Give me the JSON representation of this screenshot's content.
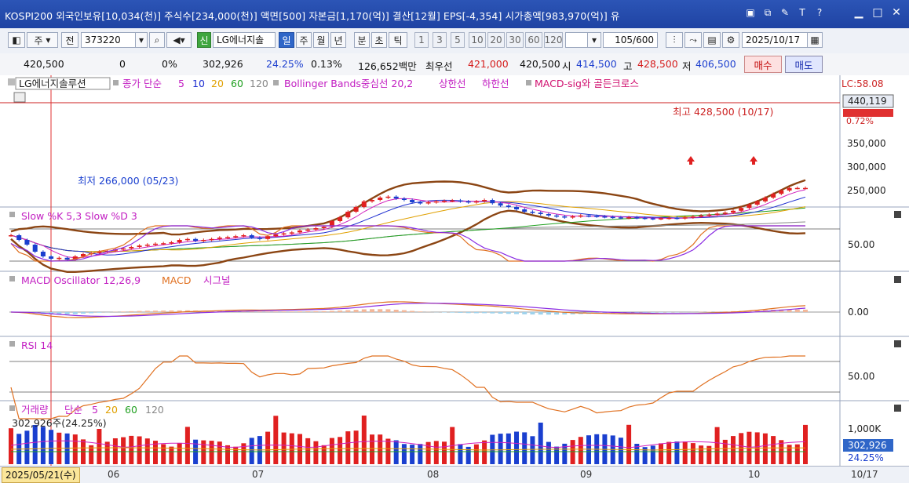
{
  "titlebar": {
    "text": "KOSPI200 외국인보유[10,034(천)] 주식수[234,000(천)] 액면[500] 자본금[1,170(억)] 결산[12월] EPS[-4,354] 시가총액[983,970(억)] 유",
    "icons": [
      "layout-icon",
      "copy-icon",
      "settings-icon",
      "text-icon",
      "help-icon"
    ],
    "window_buttons": [
      "minimize",
      "maximize",
      "close"
    ]
  },
  "toolbar": {
    "mode": "주",
    "prev_label": "전",
    "code": "373220",
    "new_label": "신",
    "stock_name": "LG에너지솔",
    "periods": [
      "일",
      "주",
      "월",
      "년",
      "분",
      "초",
      "틱"
    ],
    "active_period": "일",
    "numbers": [
      "1",
      "3",
      "5",
      "10",
      "20",
      "30",
      "60",
      "120"
    ],
    "count": "105/600",
    "date": "2025/10/17"
  },
  "quote": {
    "price": "420,500",
    "change": "0",
    "change_pct": "0%",
    "volume": "302,926",
    "volume_pct": "24.25%",
    "turnover": "0.13%",
    "amount": "126,652백만",
    "best_bid_label": "최우선",
    "best_ask": "421,000",
    "best_bid": "420,500",
    "open_label": "시",
    "open": "414,500",
    "high_label": "고",
    "high": "428,500",
    "low_label": "저",
    "low": "406,500",
    "buy_label": "매수",
    "sell_label": "매도"
  },
  "legend_price": {
    "name": "LG에너지솔루션",
    "ma_label": "종가 단순",
    "ma_periods": [
      "5",
      "10",
      "20",
      "60",
      "120"
    ],
    "bollinger": "Bollinger Bands중심선 20,2",
    "upper": "상한선",
    "lower": "하한선",
    "macd_sig": "MACD-sig와 골든크로스",
    "lc": "LC:58.08",
    "price_tag": "440,119",
    "hidden_tag": "428,500",
    "pct_tag": "0.72%",
    "high_note": "최고 428,500 (10/17)",
    "low_note": "최저 266,000 (05/23)"
  },
  "panels": {
    "stoch": "Slow %K 5,3  Slow %D 3",
    "macd_osc": "MACD Oscillator 12,26,9",
    "macd": "MACD",
    "signal": "시그널",
    "rsi": "RSI 14",
    "volume": "거래량",
    "vol_ma": "단순",
    "vol_ma_periods": [
      "5",
      "20",
      "60",
      "120"
    ],
    "vol_value": "302,926주(24.25%)"
  },
  "axis": {
    "price_ticks": [
      "350,000",
      "300,000",
      "250,000"
    ],
    "stoch_tick": "50.00",
    "macd_tick": "0.00",
    "rsi_tick": "50.00",
    "vol_tick": "1,000K",
    "vol_tag": "302,926",
    "vol_pct": "24.25%"
  },
  "bottom": {
    "date": "2025/05/21(수)",
    "months": [
      "06",
      "07",
      "08",
      "09",
      "10"
    ],
    "last": "10/17"
  },
  "colors": {
    "up": "#e02020",
    "down": "#1a3fcf",
    "bollinger": "#8b4513",
    "ma5": "#d11fbd",
    "ma10": "#1f2fd1",
    "ma20": "#e0a000",
    "ma60": "#21a021",
    "ma120": "#888888"
  },
  "chart_data": {
    "type": "line",
    "x_range": [
      "2025/05/21",
      "2025/10/17"
    ],
    "months": [
      "06",
      "07",
      "08",
      "09",
      "10"
    ],
    "price_axis": [
      250000,
      300000,
      350000
    ],
    "high": {
      "value": 428500,
      "date": "10/17"
    },
    "low": {
      "value": 266000,
      "date": "05/23"
    },
    "close": [
      320000,
      310000,
      300000,
      285000,
      275000,
      270000,
      272000,
      268000,
      275000,
      280000,
      282000,
      285000,
      287000,
      290000,
      292000,
      295000,
      298000,
      300000,
      302000,
      303000,
      305000,
      310000,
      312000,
      308000,
      310000,
      312000,
      315000,
      316000,
      318000,
      320000,
      315000,
      312000,
      318000,
      322000,
      324000,
      326000,
      330000,
      332000,
      335000,
      338000,
      350000,
      358000,
      370000,
      380000,
      392000,
      395000,
      400000,
      402000,
      398000,
      395000,
      390000,
      388000,
      390000,
      392000,
      393000,
      394000,
      392000,
      390000,
      392000,
      395000,
      388000,
      383000,
      380000,
      375000,
      370000,
      368000,
      365000,
      362000,
      360000,
      358000,
      360000,
      362000,
      361000,
      360000,
      359000,
      358000,
      357000,
      358000,
      357000,
      356000,
      355000,
      356000,
      357000,
      356000,
      358000,
      360000,
      362000,
      364000,
      366000,
      368000,
      372000,
      378000,
      385000,
      392000,
      400000,
      408000,
      415000,
      420500,
      420500,
      420500
    ]
  }
}
